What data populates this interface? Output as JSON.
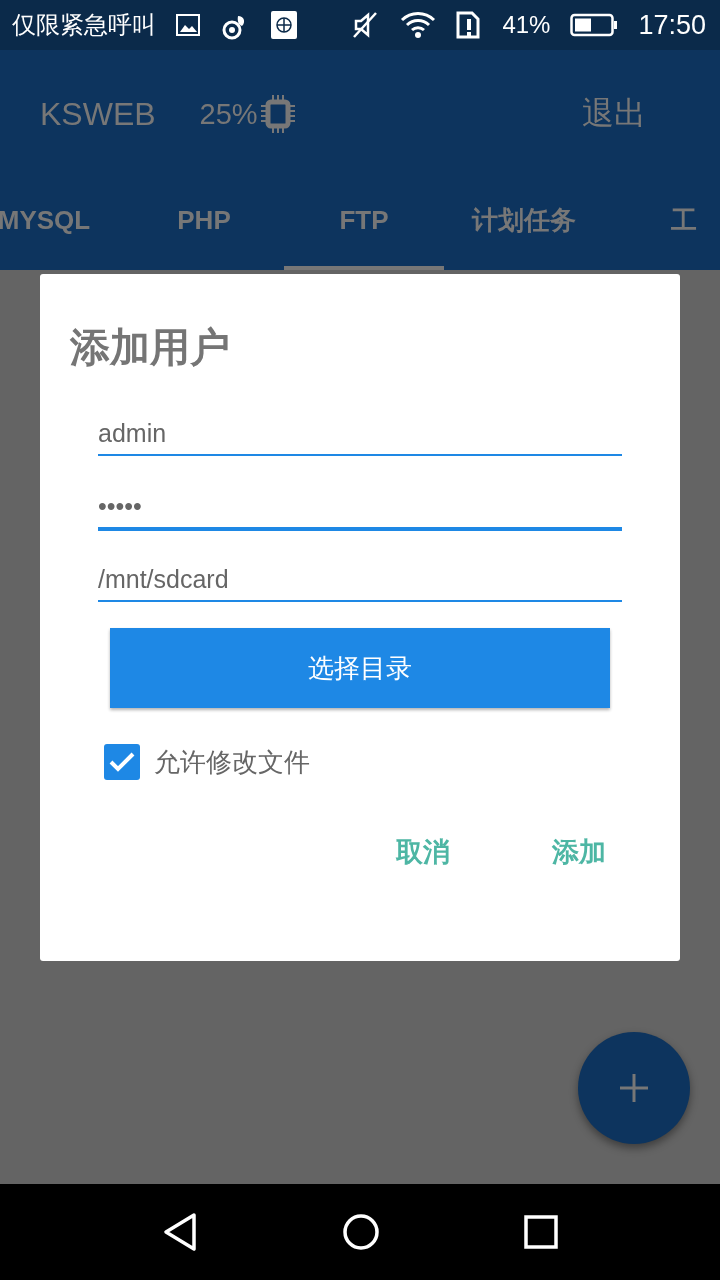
{
  "status_bar": {
    "carrier": "仅限紧急呼叫",
    "battery_percent": "41%",
    "time": "17:50"
  },
  "app_bar": {
    "title": "KSWEB",
    "cpu": "25%",
    "exit": "退出"
  },
  "tabs": [
    {
      "label": "MYSQL",
      "selected": false
    },
    {
      "label": "PHP",
      "selected": false
    },
    {
      "label": "FTP",
      "selected": true
    },
    {
      "label": "计划任务",
      "selected": false
    },
    {
      "label": "工",
      "selected": false
    }
  ],
  "dialog": {
    "title": "添加用户",
    "fields": [
      {
        "value": "admin",
        "focused": false
      },
      {
        "value": "•••••",
        "focused": true
      },
      {
        "value": "/mnt/sdcard",
        "focused": false
      }
    ],
    "choose_button": "选择目录",
    "checkbox": {
      "label": "允许修改文件",
      "checked": true
    },
    "actions": [
      "取消",
      "添加"
    ]
  }
}
